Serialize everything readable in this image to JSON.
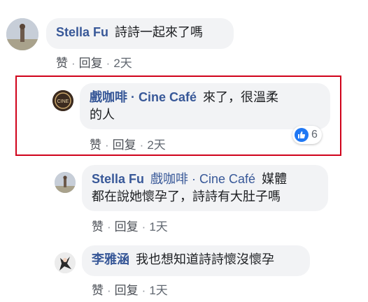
{
  "comments": [
    {
      "author": "Stella Fu",
      "text": "詩詩一起來了嗎",
      "actions": {
        "like": "赞",
        "reply": "回复",
        "time": "2天"
      }
    },
    {
      "author": "戲咖啡 · Cine Café",
      "text_line1": "來了，很溫柔",
      "text_line2": "的人",
      "actions": {
        "like": "赞",
        "reply": "回复",
        "time": "2天"
      },
      "reaction_count": "6"
    },
    {
      "author": "Stella Fu",
      "mention": "戲咖啡 · Cine Café",
      "text_line1": "媒體",
      "text_line2": "都在說她懷孕了，詩詩有大肚子嗎",
      "actions": {
        "like": "赞",
        "reply": "回复",
        "time": "1天"
      }
    },
    {
      "author": "李雅涵",
      "text": "我也想知道詩詩懷沒懷孕",
      "actions": {
        "like": "赞",
        "reply": "回复",
        "time": "1天"
      }
    }
  ],
  "avatar_logo_text": "CINE",
  "colors": {
    "name": "#385898",
    "bubble": "#f2f3f5",
    "highlight": "#d0021b",
    "like": "#2078f4"
  }
}
